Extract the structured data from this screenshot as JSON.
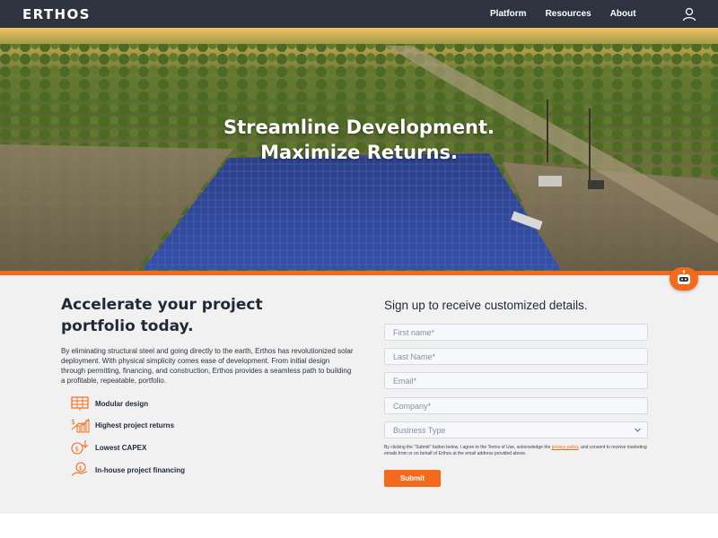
{
  "brand": {
    "logo_text": "ERTHOS",
    "accent": "#f26b1d",
    "header_bg": "#2d3440"
  },
  "nav": [
    {
      "label": "Platform"
    },
    {
      "label": "Resources"
    },
    {
      "label": "About"
    }
  ],
  "user_icon": "user-icon",
  "hero": {
    "line1": "Streamline Development.",
    "line2": "Maximize Returns."
  },
  "main": {
    "headline": "Accelerate your project portfolio today.",
    "description": "By eliminating structural steel and going directly to the earth, Erthos has revolutionized solar deployment. With physical simplicity comes ease of development. From initial design through permitting, financing, and construction, Erthos provides a seamless path to building a profitable, repeatable, portfolio.",
    "features": [
      {
        "icon": "solar-panel-icon",
        "label": "Modular design"
      },
      {
        "icon": "bar-chart-growth-icon",
        "label": "Highest project returns"
      },
      {
        "icon": "coins-arrow-down-icon",
        "label": "Lowest CAPEX"
      },
      {
        "icon": "hand-money-icon",
        "label": "In-house project financing"
      }
    ]
  },
  "form": {
    "title": "Sign up to receive customized details.",
    "first_name_placeholder": "First name*",
    "last_name_placeholder": "Last Name*",
    "email_placeholder": "Email*",
    "company_placeholder": "Company*",
    "business_type_value": "Business Type",
    "consent_before": "By clicking the \"Submit\" button below, I agree to the Terms of Use, acknowledge the ",
    "consent_link": "privacy policy",
    "consent_after": ", and consent to receive marketing emails from or on behalf of Erthos at the email address provided above.",
    "submit_label": "Submit"
  },
  "chatbot_icon": "robot-icon"
}
